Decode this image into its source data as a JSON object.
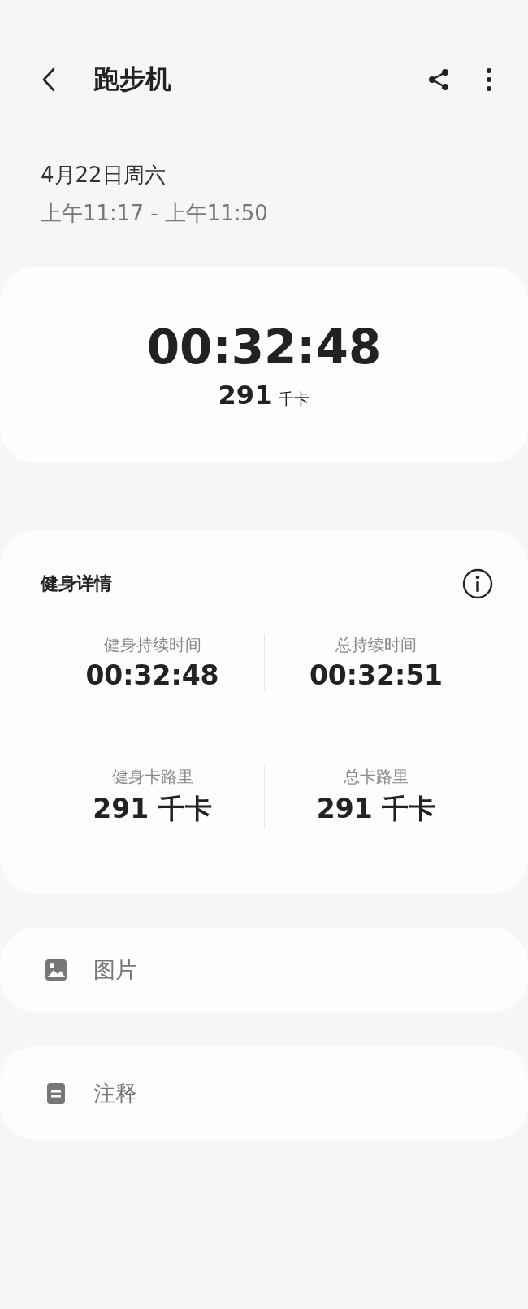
{
  "header": {
    "title": "跑步机"
  },
  "session": {
    "date": "4月22日周六",
    "time_range": "上午11:17 - 上午11:50"
  },
  "summary": {
    "duration": "00:32:48",
    "calories_value": "291",
    "calories_unit": "千卡"
  },
  "details": {
    "title": "健身详情",
    "stats": [
      {
        "label": "健身持续时间",
        "value": "00:32:48"
      },
      {
        "label": "总持续时间",
        "value": "00:32:51"
      },
      {
        "label": "健身卡路里",
        "value": "291 千卡"
      },
      {
        "label": "总卡路里",
        "value": "291 千卡"
      }
    ]
  },
  "sections": [
    {
      "kind": "image",
      "label": "图片"
    },
    {
      "kind": "note",
      "label": "注释"
    }
  ]
}
